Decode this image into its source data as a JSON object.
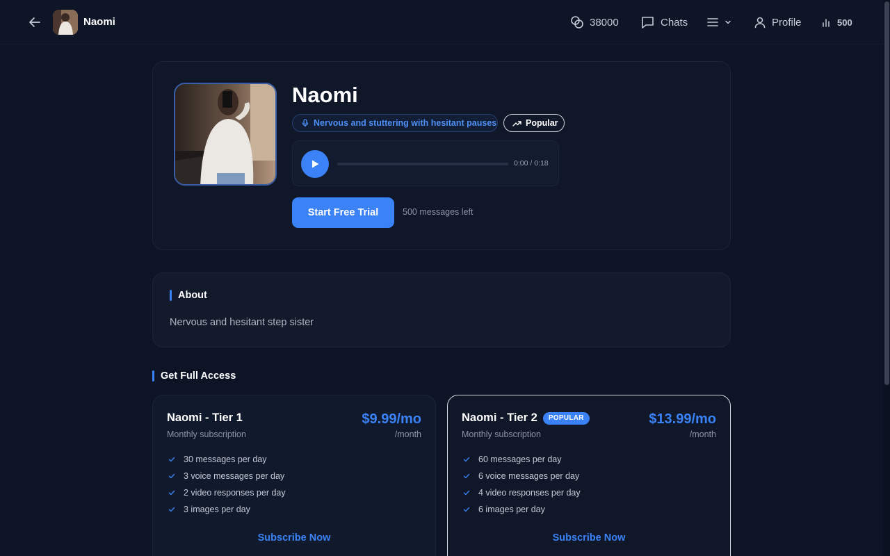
{
  "header": {
    "name": "Naomi",
    "coins": "38000",
    "chats_label": "Chats",
    "profile_label": "Profile",
    "stats_count": "500"
  },
  "profile": {
    "name": "Naomi",
    "voice_tag": "Nervous and stuttering with hesitant pauses",
    "popular_tag": "Popular",
    "audio": {
      "time": "0:00 / 0:18",
      "progress": 0
    },
    "cta_label": "Start Free Trial",
    "messages_left": "500 messages left"
  },
  "about": {
    "title": "About",
    "text": "Nervous and hesitant step sister"
  },
  "access": {
    "title": "Get Full Access"
  },
  "tiers": [
    {
      "title": "Naomi - Tier 1",
      "subtitle": "Monthly subscription",
      "price": "$9.99/mo",
      "per": "/month",
      "features": [
        "30 messages per day",
        "3 voice messages per day",
        "2 video responses per day",
        "3 images per day"
      ],
      "cta": "Subscribe Now"
    },
    {
      "title": "Naomi - Tier 2",
      "badge": "POPULAR",
      "subtitle": "Monthly subscription",
      "price": "$13.99/mo",
      "per": "/month",
      "features": [
        "60 messages per day",
        "6 voice messages per day",
        "4 video responses per day",
        "6 images per day"
      ],
      "cta": "Subscribe Now"
    }
  ],
  "colors": {
    "accent": "#3b82f6",
    "background": "#0d1425",
    "card": "#111a2c"
  },
  "icons": [
    "back-arrow-icon",
    "coins-icon",
    "chat-bubble-icon",
    "menu-icon",
    "chevron-down-icon",
    "user-icon",
    "bar-chart-icon",
    "microphone-icon",
    "trending-up-icon",
    "play-icon",
    "check-icon"
  ]
}
